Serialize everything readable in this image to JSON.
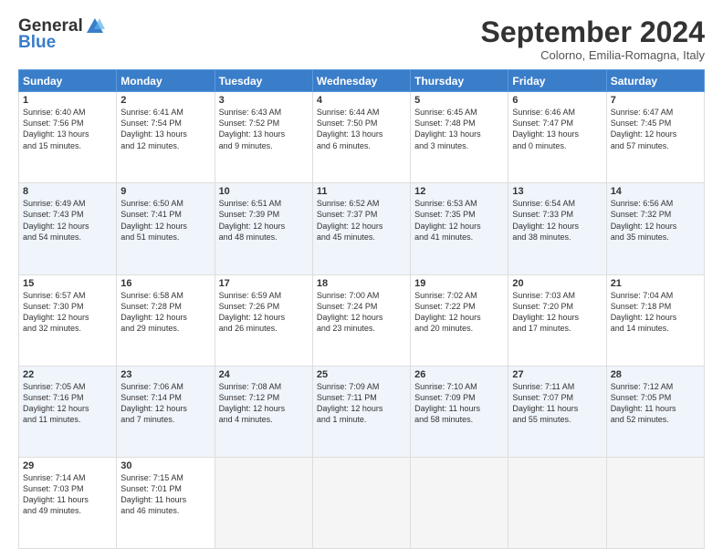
{
  "header": {
    "logo_general": "General",
    "logo_blue": "Blue",
    "month_year": "September 2024",
    "location": "Colorno, Emilia-Romagna, Italy"
  },
  "days": [
    "Sunday",
    "Monday",
    "Tuesday",
    "Wednesday",
    "Thursday",
    "Friday",
    "Saturday"
  ],
  "weeks": [
    [
      {
        "day": 1,
        "lines": [
          "Sunrise: 6:40 AM",
          "Sunset: 7:56 PM",
          "Daylight: 13 hours",
          "and 15 minutes."
        ]
      },
      {
        "day": 2,
        "lines": [
          "Sunrise: 6:41 AM",
          "Sunset: 7:54 PM",
          "Daylight: 13 hours",
          "and 12 minutes."
        ]
      },
      {
        "day": 3,
        "lines": [
          "Sunrise: 6:43 AM",
          "Sunset: 7:52 PM",
          "Daylight: 13 hours",
          "and 9 minutes."
        ]
      },
      {
        "day": 4,
        "lines": [
          "Sunrise: 6:44 AM",
          "Sunset: 7:50 PM",
          "Daylight: 13 hours",
          "and 6 minutes."
        ]
      },
      {
        "day": 5,
        "lines": [
          "Sunrise: 6:45 AM",
          "Sunset: 7:48 PM",
          "Daylight: 13 hours",
          "and 3 minutes."
        ]
      },
      {
        "day": 6,
        "lines": [
          "Sunrise: 6:46 AM",
          "Sunset: 7:47 PM",
          "Daylight: 13 hours",
          "and 0 minutes."
        ]
      },
      {
        "day": 7,
        "lines": [
          "Sunrise: 6:47 AM",
          "Sunset: 7:45 PM",
          "Daylight: 12 hours",
          "and 57 minutes."
        ]
      }
    ],
    [
      {
        "day": 8,
        "lines": [
          "Sunrise: 6:49 AM",
          "Sunset: 7:43 PM",
          "Daylight: 12 hours",
          "and 54 minutes."
        ]
      },
      {
        "day": 9,
        "lines": [
          "Sunrise: 6:50 AM",
          "Sunset: 7:41 PM",
          "Daylight: 12 hours",
          "and 51 minutes."
        ]
      },
      {
        "day": 10,
        "lines": [
          "Sunrise: 6:51 AM",
          "Sunset: 7:39 PM",
          "Daylight: 12 hours",
          "and 48 minutes."
        ]
      },
      {
        "day": 11,
        "lines": [
          "Sunrise: 6:52 AM",
          "Sunset: 7:37 PM",
          "Daylight: 12 hours",
          "and 45 minutes."
        ]
      },
      {
        "day": 12,
        "lines": [
          "Sunrise: 6:53 AM",
          "Sunset: 7:35 PM",
          "Daylight: 12 hours",
          "and 41 minutes."
        ]
      },
      {
        "day": 13,
        "lines": [
          "Sunrise: 6:54 AM",
          "Sunset: 7:33 PM",
          "Daylight: 12 hours",
          "and 38 minutes."
        ]
      },
      {
        "day": 14,
        "lines": [
          "Sunrise: 6:56 AM",
          "Sunset: 7:32 PM",
          "Daylight: 12 hours",
          "and 35 minutes."
        ]
      }
    ],
    [
      {
        "day": 15,
        "lines": [
          "Sunrise: 6:57 AM",
          "Sunset: 7:30 PM",
          "Daylight: 12 hours",
          "and 32 minutes."
        ]
      },
      {
        "day": 16,
        "lines": [
          "Sunrise: 6:58 AM",
          "Sunset: 7:28 PM",
          "Daylight: 12 hours",
          "and 29 minutes."
        ]
      },
      {
        "day": 17,
        "lines": [
          "Sunrise: 6:59 AM",
          "Sunset: 7:26 PM",
          "Daylight: 12 hours",
          "and 26 minutes."
        ]
      },
      {
        "day": 18,
        "lines": [
          "Sunrise: 7:00 AM",
          "Sunset: 7:24 PM",
          "Daylight: 12 hours",
          "and 23 minutes."
        ]
      },
      {
        "day": 19,
        "lines": [
          "Sunrise: 7:02 AM",
          "Sunset: 7:22 PM",
          "Daylight: 12 hours",
          "and 20 minutes."
        ]
      },
      {
        "day": 20,
        "lines": [
          "Sunrise: 7:03 AM",
          "Sunset: 7:20 PM",
          "Daylight: 12 hours",
          "and 17 minutes."
        ]
      },
      {
        "day": 21,
        "lines": [
          "Sunrise: 7:04 AM",
          "Sunset: 7:18 PM",
          "Daylight: 12 hours",
          "and 14 minutes."
        ]
      }
    ],
    [
      {
        "day": 22,
        "lines": [
          "Sunrise: 7:05 AM",
          "Sunset: 7:16 PM",
          "Daylight: 12 hours",
          "and 11 minutes."
        ]
      },
      {
        "day": 23,
        "lines": [
          "Sunrise: 7:06 AM",
          "Sunset: 7:14 PM",
          "Daylight: 12 hours",
          "and 7 minutes."
        ]
      },
      {
        "day": 24,
        "lines": [
          "Sunrise: 7:08 AM",
          "Sunset: 7:12 PM",
          "Daylight: 12 hours",
          "and 4 minutes."
        ]
      },
      {
        "day": 25,
        "lines": [
          "Sunrise: 7:09 AM",
          "Sunset: 7:11 PM",
          "Daylight: 12 hours",
          "and 1 minute."
        ]
      },
      {
        "day": 26,
        "lines": [
          "Sunrise: 7:10 AM",
          "Sunset: 7:09 PM",
          "Daylight: 11 hours",
          "and 58 minutes."
        ]
      },
      {
        "day": 27,
        "lines": [
          "Sunrise: 7:11 AM",
          "Sunset: 7:07 PM",
          "Daylight: 11 hours",
          "and 55 minutes."
        ]
      },
      {
        "day": 28,
        "lines": [
          "Sunrise: 7:12 AM",
          "Sunset: 7:05 PM",
          "Daylight: 11 hours",
          "and 52 minutes."
        ]
      }
    ],
    [
      {
        "day": 29,
        "lines": [
          "Sunrise: 7:14 AM",
          "Sunset: 7:03 PM",
          "Daylight: 11 hours",
          "and 49 minutes."
        ]
      },
      {
        "day": 30,
        "lines": [
          "Sunrise: 7:15 AM",
          "Sunset: 7:01 PM",
          "Daylight: 11 hours",
          "and 46 minutes."
        ]
      },
      null,
      null,
      null,
      null,
      null
    ]
  ]
}
